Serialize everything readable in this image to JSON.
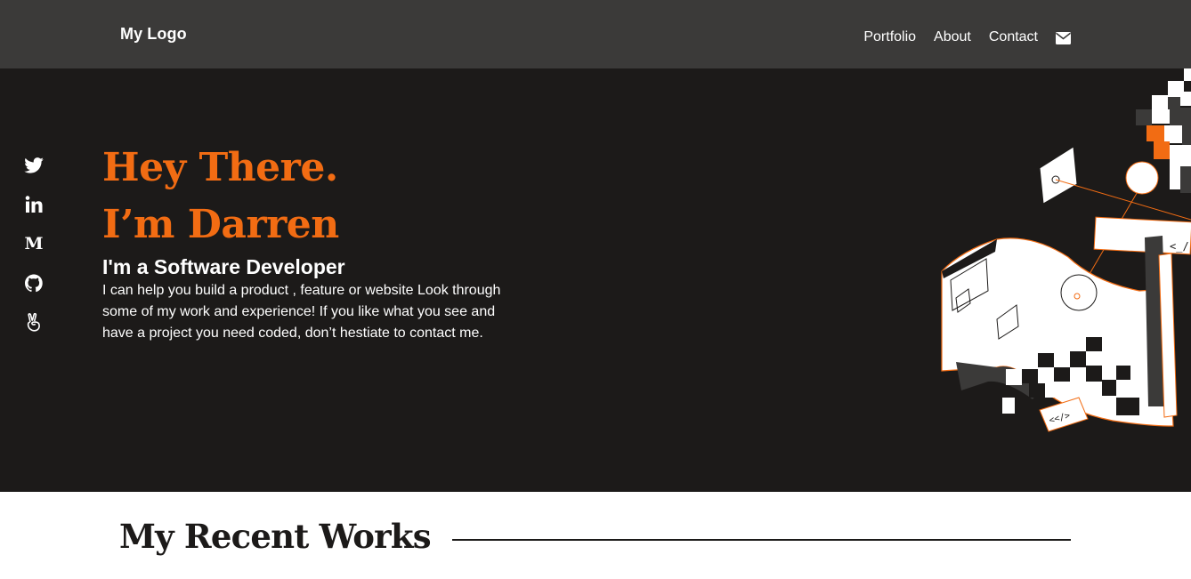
{
  "nav": {
    "logo": "My Logo",
    "links": [
      "Portfolio",
      "About",
      "Contact"
    ],
    "mail_icon": "envelope-icon"
  },
  "hero": {
    "greeting_line1": "Hey There.",
    "greeting_line2": "I’m Darren",
    "role": "I'm a Software Developer",
    "bio": "I can help you build a product , feature or website Look through some of my work and experience! If you like what you see and have a project you need coded, don’t hestiate to contact me.",
    "socials": [
      "twitter-icon",
      "linkedin-icon",
      "medium-icon",
      "github-icon",
      "angellist-icon"
    ],
    "medium_glyph": "M",
    "illustration_code_tags": [
      "<_/",
      "<</>"
    ]
  },
  "works": {
    "title": "My Recent Works"
  },
  "colors": {
    "accent": "#f26c13",
    "nav_bg": "#3b3a39",
    "hero_bg": "#1c1a19",
    "text_light": "#ffffff",
    "text_dark": "#1c1a19"
  }
}
